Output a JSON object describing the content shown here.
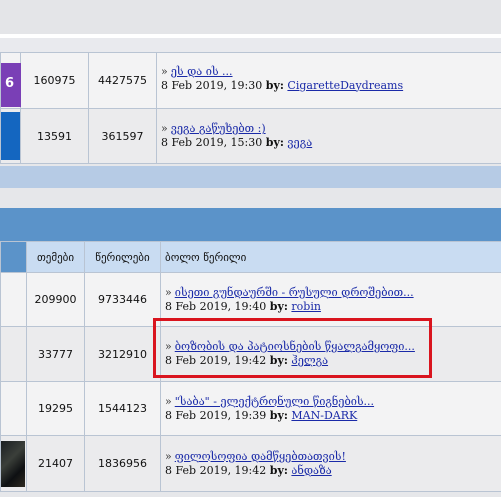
{
  "rows_top": [
    {
      "topics": "160975",
      "posts": "4427575",
      "link": "ეს და ის ...",
      "date": "8 Feb 2019, 19:30",
      "by": "by:",
      "user": "CigaretteDaydreams",
      "icon_badge": "6"
    },
    {
      "topics": "13591",
      "posts": "361597",
      "link": "ვეგა გაწუხებთ :)",
      "date": "8 Feb 2019, 15:30",
      "by": "by:",
      "user": "ვეგა"
    }
  ],
  "header": {
    "topics": "თემები",
    "posts": "წერილები",
    "last": "ბოლო წერილი"
  },
  "rows_bottom": [
    {
      "topics": "209900",
      "posts": "9733446",
      "link": "ისეთი გუნდაურში - რუსული დროშებით...",
      "date": "8 Feb 2019, 19:40",
      "by": "by:",
      "user": "robin"
    },
    {
      "topics": "33777",
      "posts": "3212910",
      "link": "ბოზობის და პატიოსნების წყალგამყოფი...",
      "date": "8 Feb 2019, 19:42",
      "by": "by:",
      "user": "ჰელგა"
    },
    {
      "topics": "19295",
      "posts": "1544123",
      "link": "\"საბა\" - ელექტრონული წიგნების...",
      "date": "8 Feb 2019, 19:39",
      "by": "by:",
      "user": "MAN-DARK"
    },
    {
      "topics": "21407",
      "posts": "1836956",
      "link": "ფილოსოფია დამწყებთათვის!",
      "date": "8 Feb 2019, 19:42",
      "by": "by:",
      "user": "ანდაზა"
    }
  ],
  "colors": {
    "accent": "#5b93c9",
    "highlight": "#d9141e",
    "link": "#1a2aa8"
  }
}
